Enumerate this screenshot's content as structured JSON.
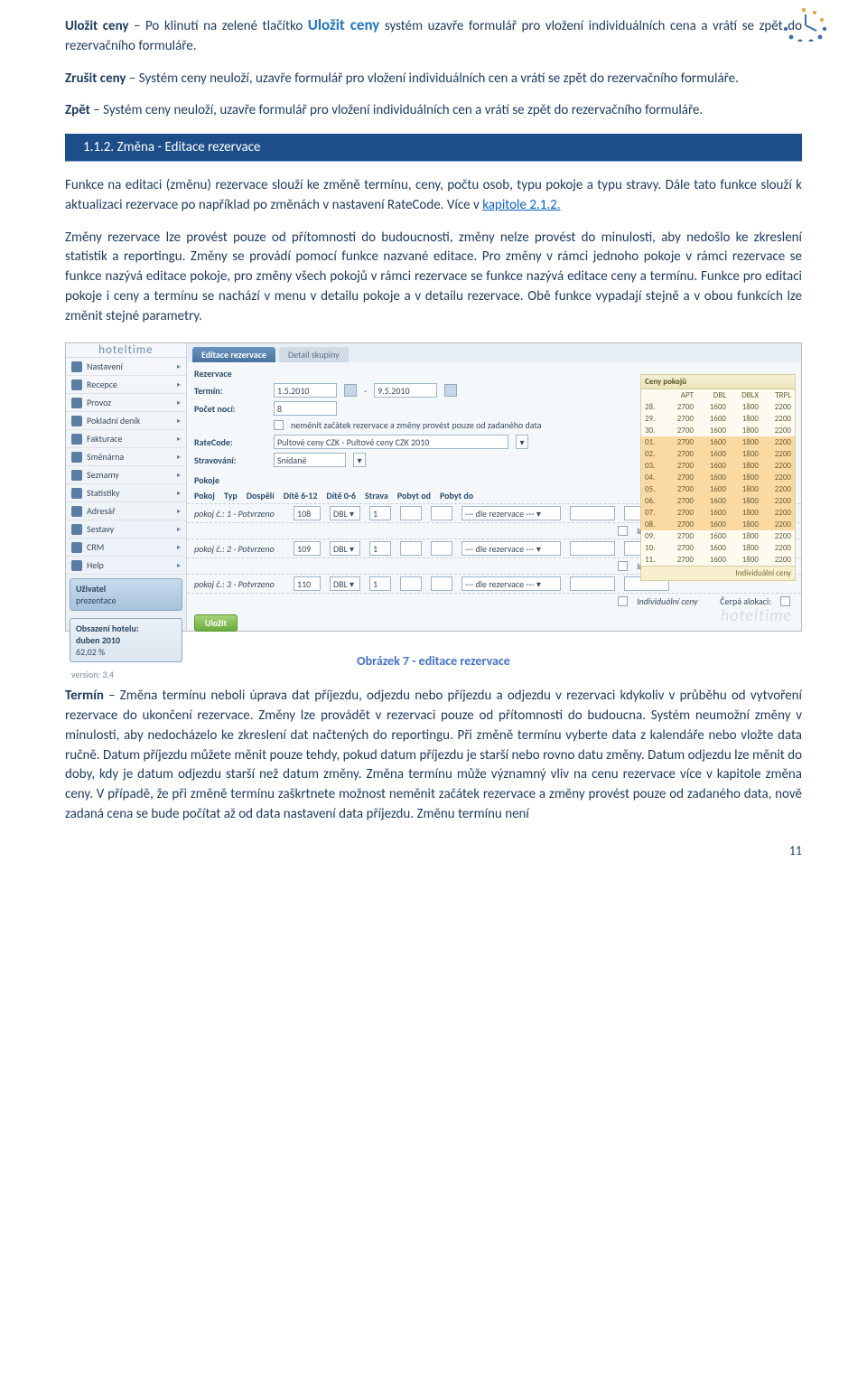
{
  "logo_alt": "hoteltime clock logo",
  "para1": {
    "kw": "Uložit ceny",
    "t1": " – Po klinutí na zelené tlačítko ",
    "kw2": "Uložit ceny",
    "t2": " systém uzavře formulář pro vložení individuálních cena a vrátí se zpět do rezervačního formuláře."
  },
  "para2": {
    "kw": "Zrušit ceny",
    "t": " – Systém ceny neuloží, uzavře formulář pro vložení individuálních cen a vrátí se zpět do rezervačního formuláře."
  },
  "para3": {
    "kw": "Zpět",
    "t": " – Systém ceny neuloží, uzavře formulář pro vložení individuálních cen a vrátí se zpět do rezervačního formuláře."
  },
  "section": {
    "num": "1.1.2.",
    "title": "Změna - Editace rezervace"
  },
  "para4a": "Funkce na editaci (změnu) rezervace slouží ke změně termínu, ceny, počtu osob, typu pokoje a typu stravy. Dále tato funkce slouží k aktualizaci rezervace po například po změnách v nastavení RateCode. Více v ",
  "para4link": "kapitole 2.1.2.",
  "para5": "Změny rezervace lze provést pouze od přítomnosti do budoucnosti, změny nelze provést do minulosti, aby nedošlo ke zkreslení statistik a reportingu. Změny se provádí pomocí funkce nazvané editace. Pro změny v rámci jednoho pokoje v rámci rezervace se funkce nazývá editace pokoje, pro změny všech pokojů v rámci rezervace se funkce nazývá editace ceny a termínu. Funkce pro editaci pokoje i ceny a termínu se nachází v menu v detailu pokoje a v detailu rezervace. Obě funkce vypadají stejně a v obou funkcích lze změnit stejné parametry.",
  "app": {
    "logo": "hoteltime",
    "sidebar_items": [
      "Nastavení",
      "Recepce",
      "Provoz",
      "Pokladní deník",
      "Fakturace",
      "Směnárna",
      "Seznamy",
      "Statistiky",
      "Adresář",
      "Sestavy",
      "CRM",
      "Help"
    ],
    "user_box": {
      "l1": "Uživatel",
      "l2": "prezentace"
    },
    "occ_box": {
      "l1": "Obsazení hotelu:",
      "l2": "duben 2010",
      "l3": "62,02 %"
    },
    "version": "version: 3.4",
    "tabs": {
      "active": "Editace rezervace",
      "inactive": "Detail skupiny"
    },
    "section1": "Rezervace",
    "termin_label": "Termín:",
    "termin_from": "1.5.2010",
    "termin_to": "9.5.2010",
    "noci_label": "Počet nocí:",
    "noci_val": "8",
    "chk_label": "neměnit začátek rezervace a změny provést pouze od zadaného data",
    "rate_label": "RateCode:",
    "rate_val": "Pultové ceny CZK - Pultové ceny CZK 2010",
    "strav_label": "Stravování:",
    "strav_val": "Snídaně",
    "section2": "Pokoje",
    "hdr": [
      "Pokoj",
      "Typ",
      "Dospělí",
      "Dítě 6-12",
      "Dítě 0-6",
      "Strava",
      "Pobyt od",
      "Pobyt do"
    ],
    "rooms": [
      {
        "label": "pokoj č.: 1 - Potvrzeno",
        "pokoj": "108",
        "typ": "DBL",
        "dosp": "1",
        "strava": "--- dle rezervace ---"
      },
      {
        "label": "pokoj č.: 2 - Potvrzeno",
        "pokoj": "109",
        "typ": "DBL",
        "dosp": "1",
        "strava": "--- dle rezervace ---"
      },
      {
        "label": "pokoj č.: 3 - Potvrzeno",
        "pokoj": "110",
        "typ": "DBL",
        "dosp": "1",
        "strava": "--- dle rezervace ---"
      }
    ],
    "indiv_label": "Individuální ceny",
    "cerpa_label": "Čerpá alokaci:",
    "save_btn": "Uložit",
    "ceny": {
      "title": "Ceny pokojů",
      "cols": [
        "",
        "APT",
        "DBL",
        "DBLX",
        "TRPL"
      ],
      "rows": [
        [
          "28.",
          "2700",
          "1600",
          "1800",
          "2200"
        ],
        [
          "29.",
          "2700",
          "1600",
          "1800",
          "2200"
        ],
        [
          "30.",
          "2700",
          "1600",
          "1800",
          "2200"
        ],
        [
          "01.",
          "2700",
          "1600",
          "1800",
          "2200"
        ],
        [
          "02.",
          "2700",
          "1600",
          "1800",
          "2200"
        ],
        [
          "03.",
          "2700",
          "1600",
          "1800",
          "2200"
        ],
        [
          "04.",
          "2700",
          "1600",
          "1800",
          "2200"
        ],
        [
          "05.",
          "2700",
          "1600",
          "1800",
          "2200"
        ],
        [
          "06.",
          "2700",
          "1600",
          "1800",
          "2200"
        ],
        [
          "07.",
          "2700",
          "1600",
          "1800",
          "2200"
        ],
        [
          "08.",
          "2700",
          "1600",
          "1800",
          "2200"
        ],
        [
          "09.",
          "2700",
          "1600",
          "1800",
          "2200"
        ],
        [
          "10.",
          "2700",
          "1600",
          "1800",
          "2200"
        ],
        [
          "11.",
          "2700",
          "1600",
          "1800",
          "2200"
        ]
      ],
      "footer": "Individuální ceny"
    },
    "footer_logo": "hoteltime"
  },
  "caption": "Obrázek 7 - editace rezervace",
  "para6": {
    "kw": "Termín",
    "t": " – Změna termínu neboli úprava dat příjezdu, odjezdu nebo příjezdu a odjezdu v rezervaci kdykoliv v průběhu od vytvoření rezervace do ukončení rezervace. Změny lze provádět v rezervaci pouze od přítomnosti do budoucna. Systém neumožní změny v minulosti, aby nedocházelo ke zkreslení dat načtených do reportingu. Při změně termínu vyberte data z kalendáře nebo vložte data ručně. Datum příjezdu můžete měnit pouze tehdy, pokud datum příjezdu je starší nebo rovno datu změny. Datum odjezdu lze měnit do doby, kdy je datum odjezdu starší než datum změny. Změna termínu může významný vliv na cenu rezervace více v kapitole změna ceny. V případě, že při změně termínu zaškrtnete možnost neměnit začátek rezervace a změny provést pouze od zadaného data, nově zadaná cena se bude počítat až od data nastavení data příjezdu. Změnu termínu není"
  },
  "pagenum": "11"
}
